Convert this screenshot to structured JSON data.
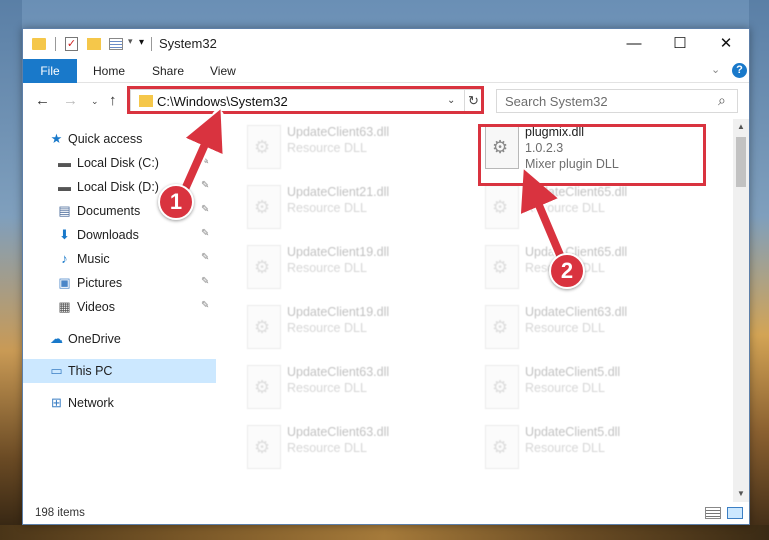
{
  "window": {
    "title": "System32",
    "quick_access_toolbar": [
      "folder-icon",
      "properties-check-icon",
      "new-folder-icon",
      "rename-icon"
    ],
    "controls": {
      "minimize": "—",
      "maximize": "☐",
      "close": "✕"
    }
  },
  "ribbon": {
    "tabs": [
      {
        "label": "File"
      },
      {
        "label": "Home"
      },
      {
        "label": "Share"
      },
      {
        "label": "View"
      }
    ],
    "expand_chevron": "⌄",
    "help": "?"
  },
  "navigation": {
    "back": "←",
    "forward": "→",
    "recent": "⌄",
    "up": "↑",
    "address": "C:\\Windows\\System32",
    "address_dropdown": "⌄",
    "refresh": "↻",
    "search_placeholder": "Search System32",
    "search_icon_glyph": "⌕"
  },
  "sidebar": {
    "items": [
      {
        "label": "Quick access",
        "icon": "star-icon",
        "glyph": "★",
        "color": "#1979ca",
        "pinned": false
      },
      {
        "label": "Local Disk (C:)",
        "icon": "drive-icon",
        "glyph": "▬",
        "color": "#555555",
        "pinned": true
      },
      {
        "label": "Local Disk (D:)",
        "icon": "drive-icon",
        "glyph": "▬",
        "color": "#555555",
        "pinned": true
      },
      {
        "label": "Documents",
        "icon": "documents-icon",
        "glyph": "▤",
        "color": "#4a6a9a",
        "pinned": true
      },
      {
        "label": "Downloads",
        "icon": "download-icon",
        "glyph": "⬇",
        "color": "#1979ca",
        "pinned": true
      },
      {
        "label": "Music",
        "icon": "music-icon",
        "glyph": "♪",
        "color": "#1979ca",
        "pinned": true
      },
      {
        "label": "Pictures",
        "icon": "pictures-icon",
        "glyph": "▣",
        "color": "#4a86c8",
        "pinned": true
      },
      {
        "label": "Videos",
        "icon": "videos-icon",
        "glyph": "▦",
        "color": "#555555",
        "pinned": true
      },
      {
        "label": "OneDrive",
        "icon": "cloud-icon",
        "glyph": "☁",
        "color": "#1979ca",
        "pinned": false
      },
      {
        "label": "This PC",
        "icon": "computer-icon",
        "glyph": "▭",
        "color": "#3c7fc4",
        "pinned": false,
        "selected": true
      },
      {
        "label": "Network",
        "icon": "network-icon",
        "glyph": "⊞",
        "color": "#3c7fc4",
        "pinned": false
      }
    ],
    "pin_glyph": "✎"
  },
  "files": {
    "left_column": [
      {
        "name": "UpdateClient63.dll",
        "type": "Resource DLL"
      },
      {
        "name": "UpdateClient21.dll",
        "type": "Resource DLL"
      },
      {
        "name": "UpdateClient19.dll",
        "type": "Resource DLL"
      },
      {
        "name": "UpdateClient19.dll",
        "type": "Resource DLL"
      },
      {
        "name": "UpdateClient63.dll",
        "type": "Resource DLL"
      },
      {
        "name": "UpdateClient63.dll",
        "type": "Resource DLL"
      }
    ],
    "right_column": [
      {
        "name": "UpdateClient65.dll",
        "type": "Resource DLL"
      },
      {
        "name": "UpdateClient65.dll",
        "type": "Resource DLL"
      },
      {
        "name": "UpdateClient63.dll",
        "type": "Resource DLL"
      },
      {
        "name": "UpdateClient5.dll",
        "type": "Resource DLL"
      },
      {
        "name": "UpdateClient5.dll",
        "type": "Resource DLL"
      }
    ],
    "highlighted": {
      "name": "plugmix.dll",
      "version": "1.0.2.3",
      "description": "Mixer plugin DLL"
    }
  },
  "status": {
    "item_count": "198 items"
  },
  "callouts": {
    "step1": "1",
    "step2": "2",
    "color": "#d9333f"
  }
}
